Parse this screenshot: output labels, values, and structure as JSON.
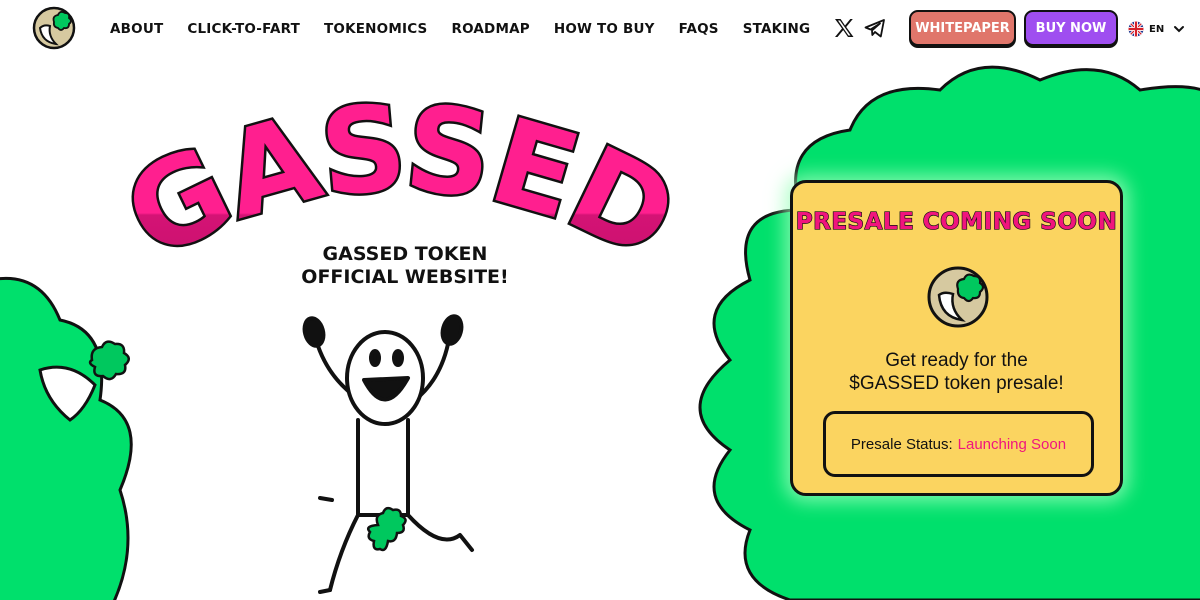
{
  "header": {
    "logo_icon": "fart-cloud-logo-icon",
    "nav": [
      {
        "label": "ABOUT"
      },
      {
        "label": "CLICK-TO-FART"
      },
      {
        "label": "TOKENOMICS"
      },
      {
        "label": "ROADMAP"
      },
      {
        "label": "HOW TO BUY"
      },
      {
        "label": "FAQS"
      },
      {
        "label": "STAKING"
      }
    ],
    "social": [
      "x-icon",
      "telegram-icon"
    ],
    "whitepaper_label": "WHITEPAPER",
    "buy_label": "BUY NOW",
    "language_code": "EN",
    "language_flag": "uk-flag-icon"
  },
  "hero": {
    "title": "GASSED",
    "subtitle_line1": "GASSED TOKEN",
    "subtitle_line2": "OFFICIAL WEBSITE!"
  },
  "presale": {
    "title": "PRESALE COMING SOON",
    "text_line1": "Get ready for the",
    "text_line2": "$GASSED token presale!",
    "status_label": "Presale Status:",
    "status_value": "Launching Soon"
  },
  "colors": {
    "accent_pink": "#f0157d",
    "green": "#00e06c",
    "card_yellow": "#fbd460",
    "whitepaper_btn": "#e0766b",
    "buy_btn": "#9f4ef0"
  }
}
